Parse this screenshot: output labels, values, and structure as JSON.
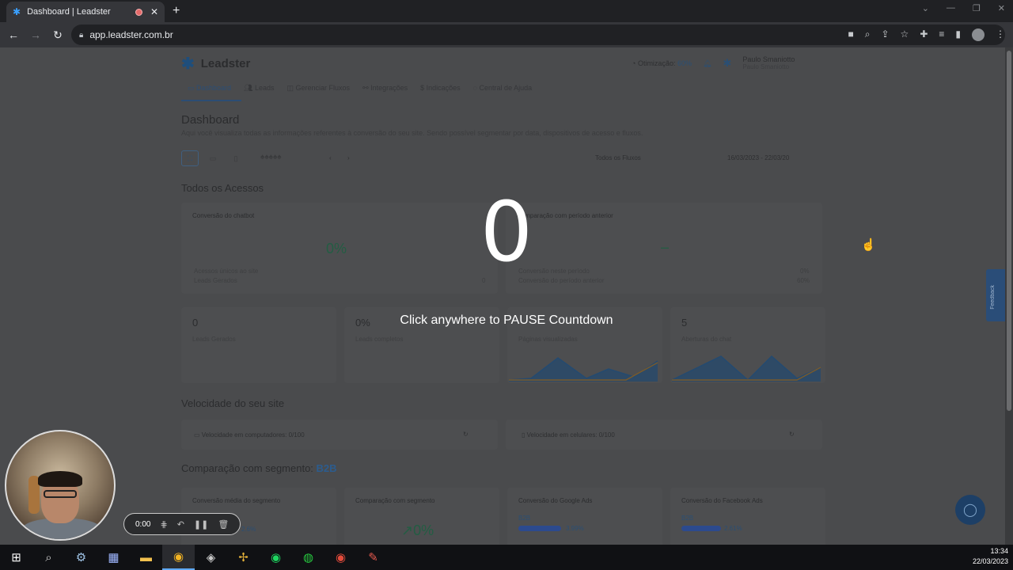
{
  "browser": {
    "tab_title": "Dashboard | Leadster",
    "url": "app.leadster.com.br",
    "favicon": "leadster-logo-icon"
  },
  "app": {
    "brand": "Leadster",
    "otimizacao_label": "Otimização:",
    "otimizacao_value": "60%",
    "user_name": "Paulo Smaniotto",
    "user_sub": "Paulo Smaniotto",
    "nav": [
      "Dashboard",
      "Leads",
      "Gerenciar Fluxos",
      "Integrações",
      "Indicações",
      "Central de Ajuda"
    ],
    "title": "Dashboard",
    "description": "Aqui você visualiza todas as informações referentes à conversão do seu site. Sendo possível segmentar por data, dispositivos de acesso e fluxos.",
    "flow_select": "Todos os Fluxos",
    "date_range": "16/03/2023 - 22/03/20"
  },
  "sections": {
    "todos": "Todos os Acessos",
    "velocidade": "Velocidade do seu site",
    "comparacao": "Comparação com segmento:",
    "segment": "B2B"
  },
  "cards": {
    "conv_chatbot": "Conversão do chatbot",
    "conv_value": "0%",
    "acessos_label": "Acessos únicos ao site",
    "leads_label": "Leads Gerados",
    "leads_value": "0",
    "comp_periodo": "Comparação com período anterior",
    "comp_dash": "–",
    "conv_periodo": "Conversão neste período",
    "conv_periodo_val": "0%",
    "conv_anterior": "Conversão do período anterior",
    "conv_anterior_val": "60%",
    "m1_value": "0",
    "m1_label": "Leads Gerados",
    "m2_value": "0%",
    "m2_label": "Leads completos",
    "m3_label": "Páginas visualizadas",
    "m4_value": "5",
    "m4_label": "Aberturas do chat",
    "vel_desktop": "Velocidade em computadores: 0/100",
    "vel_mobile": "Velocidade em celulares: 0/100",
    "seg1": "Conversão média do segmento",
    "seg1_val": "2.6%",
    "seg2": "Comparação com segmento",
    "seg2_val": "0%",
    "seg3": "Conversão do Google Ads",
    "seg3_tag": "B2B",
    "seg3_val": "3.99%",
    "seg4": "Conversão do Facebook Ads",
    "seg4_tag": "B2B",
    "seg4_val": "2.61%"
  },
  "overlay": {
    "countdown": "0",
    "hint": "Click anywhere to PAUSE Countdown"
  },
  "widgets": {
    "feedback": "Feedback"
  },
  "recorder": {
    "time": "0:00"
  },
  "taskbar": {
    "time": "13:34",
    "date": "22/03/2023"
  }
}
